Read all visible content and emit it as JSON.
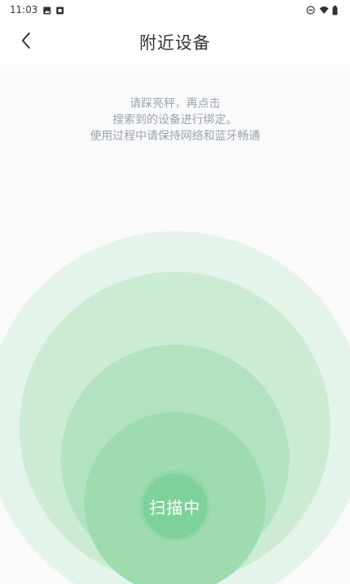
{
  "status_bar": {
    "time": "11:03",
    "icons_left": [
      "image-icon",
      "notification-icon"
    ],
    "icons_right": [
      "dnd-icon",
      "wifi-icon",
      "battery-icon"
    ]
  },
  "header": {
    "back_icon": "chevron-left-icon",
    "title": "附近设备"
  },
  "hint": {
    "line1": "请踩亮秤，再点击",
    "line2": "搜索到的设备进行绑定。",
    "line3": "使用过程中请保持网络和蓝牙畅通"
  },
  "scan": {
    "label": "扫描中"
  },
  "colors": {
    "ring1": "#e5f4ea",
    "ring2": "#cbebd5",
    "ring3": "#b2e2c0",
    "ring4": "#9edcb0",
    "button": "#7fd19a",
    "hint_text": "#9aa3b2"
  }
}
